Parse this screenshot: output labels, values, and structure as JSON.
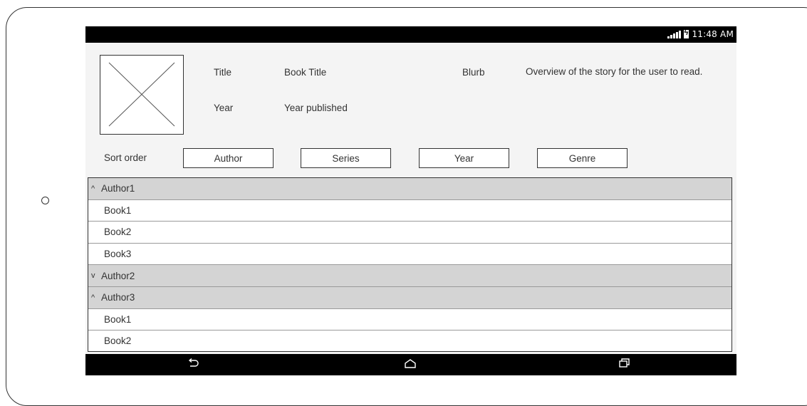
{
  "status_bar": {
    "time": "11:48 AM"
  },
  "book": {
    "title_label": "Title",
    "title_value": "Book Title",
    "year_label": "Year",
    "year_value": "Year published",
    "blurb_label": "Blurb",
    "blurb_value": "Overview of the story for the user to read."
  },
  "sort": {
    "label": "Sort order",
    "buttons": [
      "Author",
      "Series",
      "Year",
      "Genre"
    ]
  },
  "list": {
    "rows": [
      {
        "type": "group",
        "toggle": "^",
        "label": "Author1"
      },
      {
        "type": "item",
        "label": "Book1"
      },
      {
        "type": "item",
        "label": "Book2"
      },
      {
        "type": "item",
        "label": "Book3"
      },
      {
        "type": "group",
        "toggle": "v",
        "label": "Author2"
      },
      {
        "type": "group",
        "toggle": "^",
        "label": "Author3"
      },
      {
        "type": "item",
        "label": "Book1"
      },
      {
        "type": "item",
        "label": "Book2"
      }
    ]
  },
  "icons": {
    "cover": "image-placeholder-icon",
    "back": "back-icon",
    "home": "home-icon",
    "recents": "recents-icon",
    "signal": "signal-icon",
    "battery": "battery-charging-icon"
  }
}
